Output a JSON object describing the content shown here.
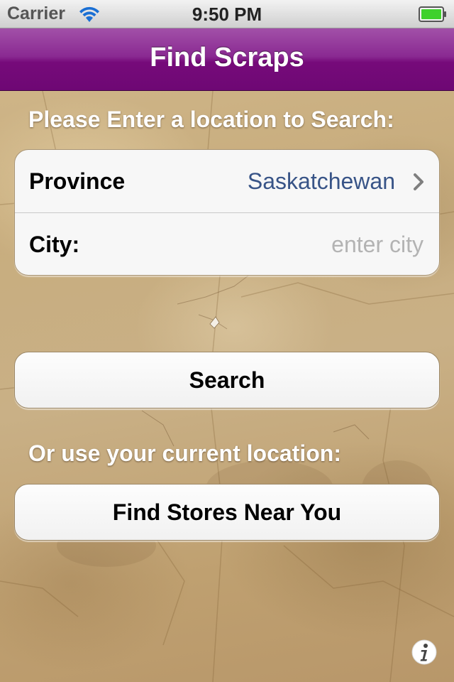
{
  "status_bar": {
    "carrier": "Carrier",
    "time": "9:50 PM",
    "wifi_icon": "wifi-icon",
    "battery_icon": "battery-icon",
    "battery_level": 1.0,
    "battery_color": "#3fd12c"
  },
  "nav": {
    "title": "Find Scraps",
    "color": "#7a0d80"
  },
  "search_section": {
    "prompt": "Please Enter a location to Search:",
    "province": {
      "label": "Province",
      "value": "Saskatchewan",
      "accessory_icon": "chevron-right-icon"
    },
    "city": {
      "label": "City:",
      "value": "",
      "placeholder": "enter city"
    },
    "search_button": "Search"
  },
  "location_section": {
    "prompt": "Or use your current location:",
    "button": "Find Stores Near You"
  },
  "footer": {
    "info_icon": "info-icon"
  },
  "colors": {
    "background": "#c8ad7e",
    "value_text": "#385487",
    "placeholder_text": "#b3b3b3"
  }
}
